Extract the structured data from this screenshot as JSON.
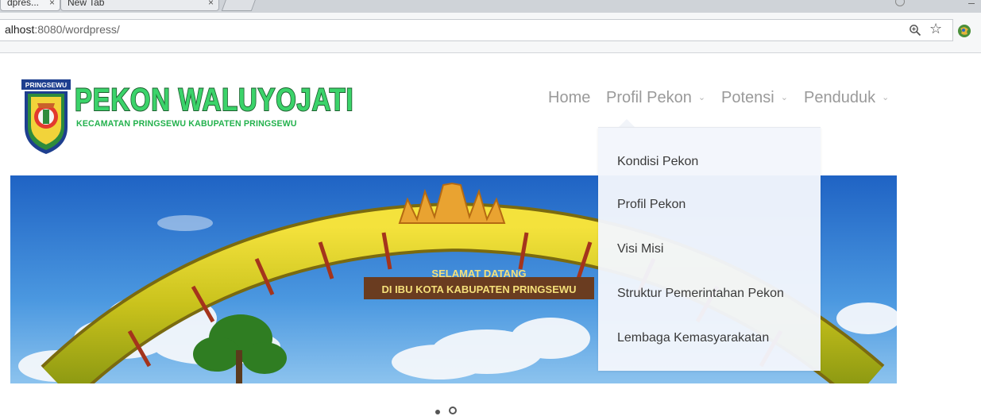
{
  "browser": {
    "tabs": [
      {
        "title": "dpres...",
        "close": "×",
        "active": true
      },
      {
        "title": "New Tab",
        "close": "×",
        "active": false
      }
    ],
    "url_prefix": "alhost",
    "url_rest": ":8080/wordpress/"
  },
  "site": {
    "logo_badge": "PRINGSEWU",
    "title": "PEKON WALUYOJATI",
    "subtitle": "KECAMATAN PRINGSEWU KABUPATEN PRINGSEWU"
  },
  "nav": {
    "items": [
      {
        "label": "Home",
        "has_submenu": false
      },
      {
        "label": "Profil Pekon",
        "has_submenu": true
      },
      {
        "label": "Potensi",
        "has_submenu": true
      },
      {
        "label": "Penduduk",
        "has_submenu": true
      }
    ],
    "chevron": "⌄",
    "open_menu": "Profil Pekon"
  },
  "dropdown": {
    "items": [
      "Kondisi Pekon",
      "Profil Pekon",
      "Visi Misi",
      "Struktur Pemerintahan Pekon",
      "Lembaga Kemasyarakatan"
    ]
  },
  "slider": {
    "banner_line1": "SELAMAT DATANG",
    "banner_line2": "DI IBU KOTA KABUPATEN PRINGSEWU",
    "slide_count": 2,
    "active_slide": 1
  },
  "colors": {
    "title_green": "#3bd36a",
    "nav_text": "#9a9a9a",
    "dropdown_bg": "#f3f6fc",
    "sky": "#3b86d6"
  }
}
